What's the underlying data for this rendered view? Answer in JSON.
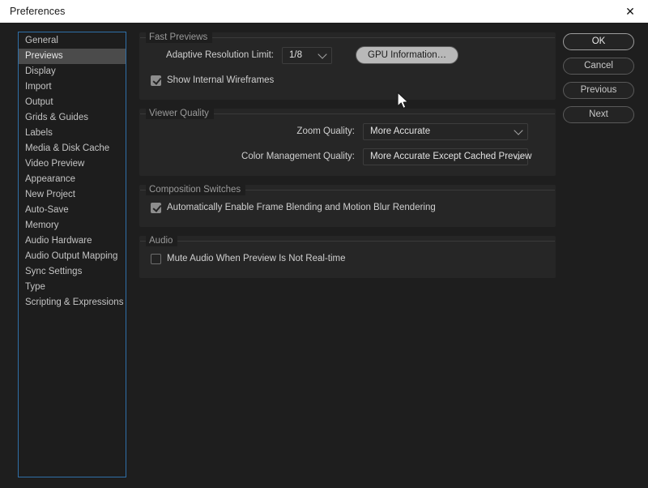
{
  "window": {
    "title": "Preferences",
    "close_label": "✕"
  },
  "sidebar": {
    "items": [
      {
        "label": "General",
        "selected": false
      },
      {
        "label": "Previews",
        "selected": true
      },
      {
        "label": "Display",
        "selected": false
      },
      {
        "label": "Import",
        "selected": false
      },
      {
        "label": "Output",
        "selected": false
      },
      {
        "label": "Grids & Guides",
        "selected": false
      },
      {
        "label": "Labels",
        "selected": false
      },
      {
        "label": "Media & Disk Cache",
        "selected": false
      },
      {
        "label": "Video Preview",
        "selected": false
      },
      {
        "label": "Appearance",
        "selected": false
      },
      {
        "label": "New Project",
        "selected": false
      },
      {
        "label": "Auto-Save",
        "selected": false
      },
      {
        "label": "Memory",
        "selected": false
      },
      {
        "label": "Audio Hardware",
        "selected": false
      },
      {
        "label": "Audio Output Mapping",
        "selected": false
      },
      {
        "label": "Sync Settings",
        "selected": false
      },
      {
        "label": "Type",
        "selected": false
      },
      {
        "label": "Scripting & Expressions",
        "selected": false
      }
    ]
  },
  "sections": {
    "fast_previews": {
      "title": "Fast Previews",
      "adaptive_resolution_label": "Adaptive Resolution Limit:",
      "adaptive_resolution_value": "1/8",
      "gpu_button_label": "GPU Information…",
      "show_internal_wireframes_label": "Show Internal Wireframes",
      "show_internal_wireframes_checked": true
    },
    "viewer_quality": {
      "title": "Viewer Quality",
      "zoom_quality_label": "Zoom Quality:",
      "zoom_quality_value": "More Accurate",
      "color_management_label": "Color Management Quality:",
      "color_management_value": "More Accurate Except Cached Preview"
    },
    "composition_switches": {
      "title": "Composition Switches",
      "auto_frame_blending_label": "Automatically Enable Frame Blending and Motion Blur Rendering",
      "auto_frame_blending_checked": true
    },
    "audio": {
      "title": "Audio",
      "mute_audio_label": "Mute Audio When Preview Is Not Real-time",
      "mute_audio_checked": false
    }
  },
  "buttons": {
    "ok": "OK",
    "cancel": "Cancel",
    "previous": "Previous",
    "next": "Next"
  },
  "colors": {
    "dialog_bg": "#1e1e1e",
    "panel_bg": "#262626",
    "focus_border": "#2f6fa8",
    "selected_row": "#4b4b4b",
    "button_highlight": "#b9b9b9"
  }
}
